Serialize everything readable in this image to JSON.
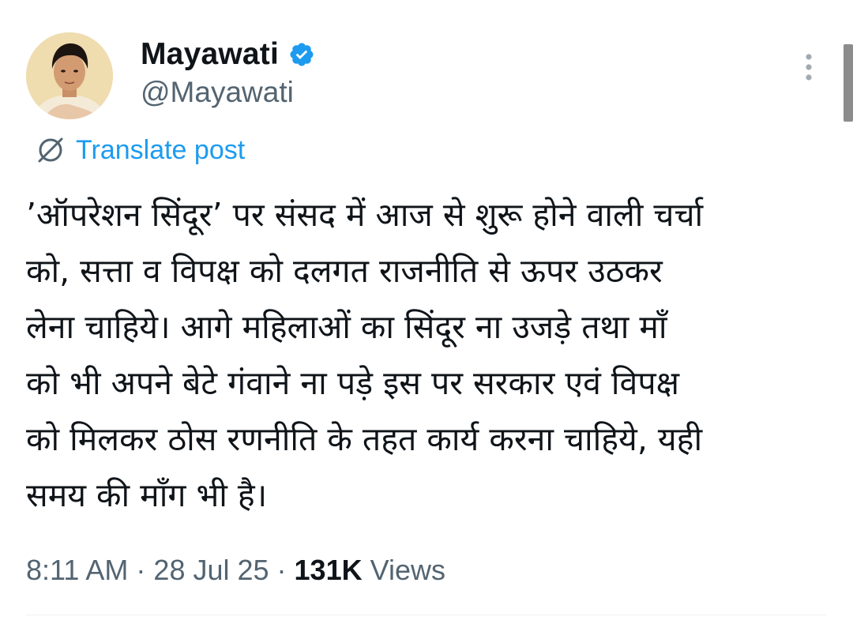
{
  "author": {
    "display_name": "Mayawati",
    "handle": "@Mayawati",
    "verified_icon": "verified-badge-icon",
    "verified_color": "#1d9bf0"
  },
  "translate": {
    "icon": "globe-slash-icon",
    "label": "Translate post"
  },
  "tweet": {
    "lines": [
      "’ऑपरेशन सिंदूर’ पर संसद में आज से शुरू होने वाली चर्चा",
      "को, सत्ता व विपक्ष को दलगत राजनीति से ऊपर उठकर",
      "लेना चाहिये। आगे महिलाओं का सिंदूर ना उजड़े तथा माँ",
      "को भी अपने बेटे गंवाने ना पड़े इस पर सरकार एवं विपक्ष",
      "को मिलकर ठोस रणनीति के तहत कार्य करना चाहिये, यही",
      "समय की माँग भी है।"
    ]
  },
  "meta": {
    "time": "8:11 AM",
    "separator": "·",
    "date": "28 Jul 25",
    "views_count": "131K",
    "views_label": "Views"
  },
  "colors": {
    "text": "#0f1419",
    "secondary": "#536471",
    "link": "#1d9bf0",
    "divider": "#eff3f4"
  }
}
